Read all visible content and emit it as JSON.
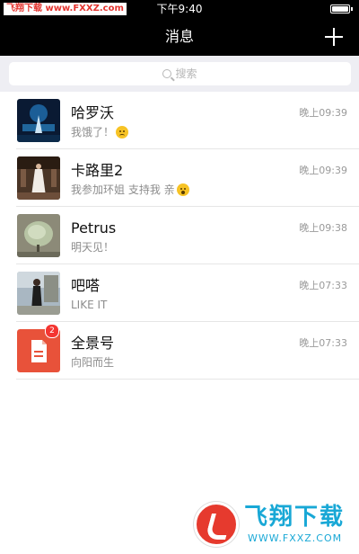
{
  "status_bar": {
    "watermark": "飞翔下载 www.FXXZ.com",
    "time": "下午9:40"
  },
  "nav": {
    "title": "消息",
    "add_icon": "plus-icon"
  },
  "search": {
    "placeholder": "搜索",
    "icon": "search-icon"
  },
  "chats": [
    {
      "name": "哈罗沃",
      "preview": "我饿了！",
      "emoji": "sad-face",
      "time": "晚上09:39"
    },
    {
      "name": "卡路里2",
      "preview": "我参加环姐 支持我 亲",
      "emoji": "surprised-face",
      "time": "晚上09:39"
    },
    {
      "name": "Petrus",
      "preview": "明天见！",
      "time": "晚上09:38"
    },
    {
      "name": "吧嗒",
      "preview": "LIKE IT",
      "time": "晚上07:33"
    },
    {
      "name": "全景号",
      "preview": "向阳而生",
      "time": "晚上07:33",
      "badge": "2"
    }
  ],
  "watermark": {
    "title": "飞翔下载",
    "url": "WWW.FXXZ.COM"
  },
  "colors": {
    "bar_bg": "#000000",
    "search_bg": "#eeeef3",
    "badge": "#f43531",
    "watermark_blue": "#19a8d6",
    "watermark_red": "#e63a2e"
  }
}
